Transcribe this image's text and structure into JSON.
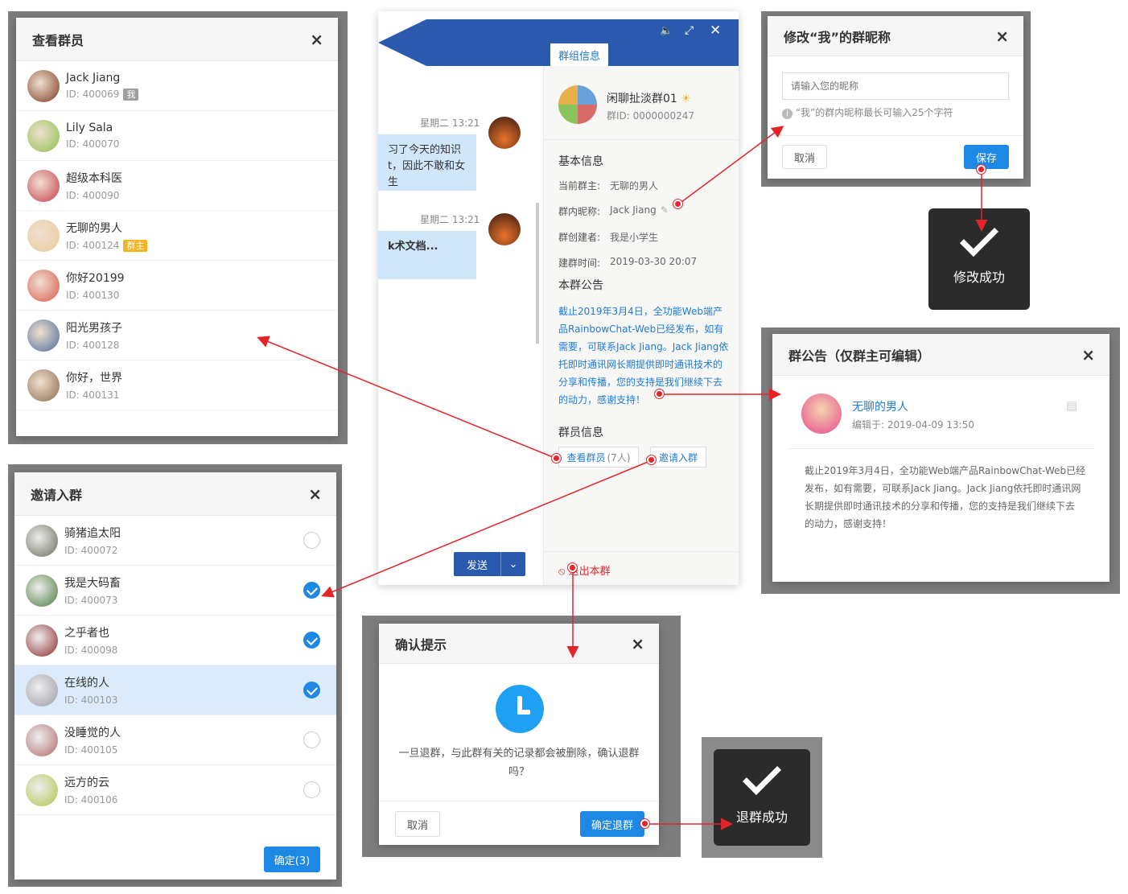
{
  "members_dialog": {
    "title": "查看群员",
    "close": "×",
    "items": [
      {
        "name": "Jack Jiang",
        "id": "ID: 400069",
        "tag": "我",
        "tag_color": "#9e9e9e",
        "avatar_color": "#7a3a1c"
      },
      {
        "name": "Lily Sala",
        "id": "ID: 400070",
        "tag": "",
        "avatar_color": "#8bbf4a"
      },
      {
        "name": "超级本科医",
        "id": "ID: 400090",
        "tag": "",
        "avatar_color": "#c43a4a"
      },
      {
        "name": "无聊的男人",
        "id": "ID: 400124",
        "tag": "群主",
        "tag_color": "#f5b323",
        "avatar_color": "#e9c99a"
      },
      {
        "name": "你好20199",
        "id": "ID: 400130",
        "tag": "",
        "avatar_color": "#d9574a"
      },
      {
        "name": "阳光男孩子",
        "id": "ID: 400128",
        "tag": "",
        "avatar_color": "#4a6a9a"
      },
      {
        "name": "你好，世界",
        "id": "ID: 400131",
        "tag": "",
        "avatar_color": "#8a6a4a"
      }
    ]
  },
  "invite_dialog": {
    "title": "邀请入群",
    "close": "×",
    "items": [
      {
        "name": "骑猪追太阳",
        "id": "ID: 400072",
        "checked": false,
        "avatar_color": "#6a6a5a"
      },
      {
        "name": "我是大码畜",
        "id": "ID: 400073",
        "checked": true,
        "avatar_color": "#4a7a3a"
      },
      {
        "name": "之乎者也",
        "id": "ID: 400098",
        "checked": true,
        "avatar_color": "#8a2a2a"
      },
      {
        "name": "在线的人",
        "id": "ID: 400103",
        "checked": true,
        "avatar_color": "#9a9aa4"
      },
      {
        "name": "没睡觉的人",
        "id": "ID: 400105",
        "checked": false,
        "avatar_color": "#b06a6a"
      },
      {
        "name": "远方的云",
        "id": "ID: 400106",
        "checked": false,
        "avatar_color": "#b0c44a"
      }
    ],
    "confirm": "确定(3)"
  },
  "chat": {
    "tab": "群组信息",
    "messages": [
      {
        "time": "星期二 13:21",
        "text_line1": "习了今天的知识",
        "text_line2": "t，因此不敢和女生"
      },
      {
        "time": "星期二 13:21",
        "text_line1": "k术文档...",
        "text_line2": ""
      }
    ],
    "send": "发送",
    "send_dropdown": "⌄",
    "group": {
      "name": "闲聊扯淡群01",
      "id": "群ID: 0000000247"
    },
    "basic_title": "基本信息",
    "owner_label": "当前群主:",
    "owner_value": "无聊的男人",
    "nick_label": "群内昵称:",
    "nick_value": "Jack Jiang",
    "creator_label": "群创建者:",
    "creator_value": "我是小学生",
    "created_label": "建群时间:",
    "created_value": "2019-03-30 20:07",
    "notice_title": "本群公告",
    "notice_lines": [
      "截止2019年3月4日，全功能Web端产",
      "品RainbowChat-Web已经发布，如有",
      "需要，可联系Jack Jiang。Jack Jiang依",
      "托即时通讯网长期提供即时通讯技术的",
      "分享和传播，您的支持是我们继续下去",
      "的动力，感谢支持！"
    ],
    "members_title": "群员信息",
    "view_members": "查看群员",
    "view_members_count": "(7人)",
    "invite": "邀请入群",
    "quit": "退出本群"
  },
  "nickname_dialog": {
    "title": "修改“我”的群昵称",
    "close": "×",
    "placeholder": "请输入您的昵称",
    "hint": "“我”的群内昵称最长可输入25个字符",
    "cancel": "取消",
    "save": "保存"
  },
  "toast_modify": {
    "text": "修改成功"
  },
  "notice_dialog": {
    "title": "群公告（仅群主可编辑）",
    "close": "×",
    "author": "无聊的男人",
    "edited": "编辑于: 2019-04-09 13:50",
    "lines": [
      "截止2019年3月4日，全功能Web端产品RainbowChat-Web已经",
      "发布，如有需要，可联系Jack Jiang。Jack Jiang依托即时通讯网",
      "长期提供即时通讯技术的分享和传播，您的支持是我们继续下去",
      "的动力，感谢支持！"
    ]
  },
  "confirm_dialog": {
    "title": "确认提示",
    "close": "×",
    "line1": "一旦退群，与此群有关的记录都会被删除，确认退群",
    "line2": "吗？",
    "cancel": "取消",
    "ok": "确定退群"
  },
  "toast_quit": {
    "text": "退群成功"
  }
}
